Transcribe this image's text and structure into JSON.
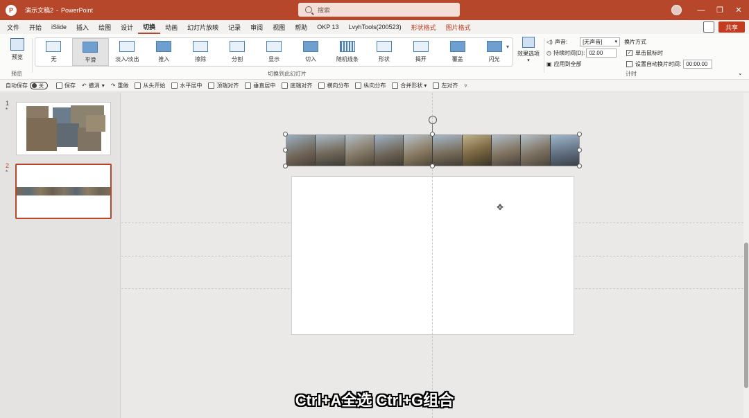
{
  "titlebar": {
    "document": "演示文稿2",
    "separator": "-",
    "app": "PowerPoint",
    "search_placeholder": "搜索",
    "brand_color": "#b7472a"
  },
  "menu": {
    "tabs": [
      {
        "label": "文件"
      },
      {
        "label": "开始"
      },
      {
        "label": "iSlide"
      },
      {
        "label": "插入"
      },
      {
        "label": "绘图"
      },
      {
        "label": "设计"
      },
      {
        "label": "切换",
        "active": true
      },
      {
        "label": "动画"
      },
      {
        "label": "幻灯片放映"
      },
      {
        "label": "记录"
      },
      {
        "label": "审阅"
      },
      {
        "label": "视图"
      },
      {
        "label": "帮助"
      },
      {
        "label": "OKP 13"
      },
      {
        "label": "LvyhTools(200523)"
      },
      {
        "label": "形状格式",
        "contextual": true
      },
      {
        "label": "图片格式",
        "contextual": true
      }
    ],
    "share": "共享"
  },
  "ribbon": {
    "preview_label": "预览",
    "preview_group": "预览",
    "gallery_group": "切换到此幻灯片",
    "effects": [
      {
        "label": "无"
      },
      {
        "label": "平滑",
        "selected": true
      },
      {
        "label": "淡入/淡出"
      },
      {
        "label": "推入"
      },
      {
        "label": "擦除"
      },
      {
        "label": "分割"
      },
      {
        "label": "显示"
      },
      {
        "label": "切入"
      },
      {
        "label": "随机线条"
      },
      {
        "label": "形状"
      },
      {
        "label": "揭开"
      },
      {
        "label": "覆盖"
      },
      {
        "label": "闪光"
      }
    ],
    "effect_options": "效果选项",
    "sound_label": "声音:",
    "sound_value": "[无声音]",
    "duration_label": "持续时间(D):",
    "duration_value": "02.00",
    "apply_all": "应用到全部",
    "advance_title": "换片方式",
    "on_click": "单击鼠标时",
    "after_label": "设置自动换片时间:",
    "after_value": "00:00.00",
    "timing_group": "计时"
  },
  "qat": {
    "autosave_label": "自动保存",
    "autosave_state": "关",
    "items": [
      "保存",
      "撤消",
      "重做",
      "从头开始",
      "水平居中",
      "顶端对齐",
      "垂直居中",
      "底端对齐",
      "横向分布",
      "纵向分布",
      "合并形状",
      "左对齐"
    ]
  },
  "slides": [
    {
      "number": "1",
      "marker": "*"
    },
    {
      "number": "2",
      "marker": "*"
    }
  ],
  "caption": "Ctrl+A全选 Ctrl+G组合"
}
